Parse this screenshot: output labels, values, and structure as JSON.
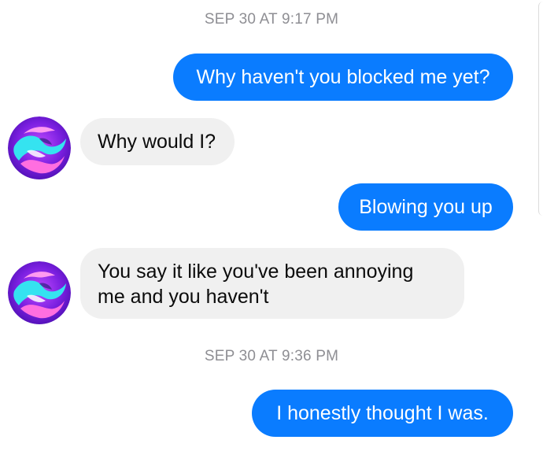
{
  "timestamps": [
    "SEP 30 AT 9:17 PM",
    "SEP 30 AT 9:36 PM"
  ],
  "messages": [
    {
      "direction": "outgoing",
      "text": "Why haven't you blocked me yet?"
    },
    {
      "direction": "incoming",
      "text": "Why would I?"
    },
    {
      "direction": "outgoing",
      "text": "Blowing you up"
    },
    {
      "direction": "incoming",
      "lines": [
        "You say it like you've been annoying",
        "me and you haven't"
      ]
    },
    {
      "direction": "outgoing",
      "text": "I honestly thought I was."
    }
  ],
  "colors": {
    "outgoing_bubble": "#0a7cff",
    "incoming_bubble": "#f0f0f0",
    "timestamp_text": "#8e8e93"
  },
  "avatar_icon": "psychedelic-swirl-avatar"
}
